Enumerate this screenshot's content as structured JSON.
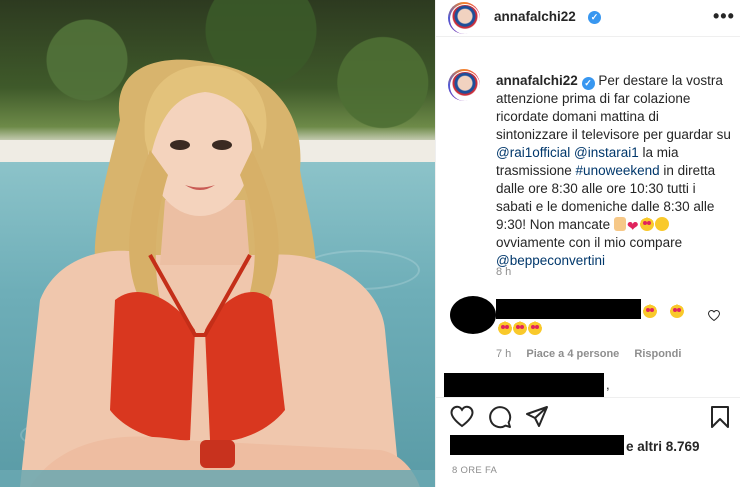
{
  "post": {
    "username": "annafalchi22",
    "more_icon": "more-horizontal-icon",
    "verified_icon": "verified-badge-icon"
  },
  "caption": {
    "username": "annafalchi22",
    "text_1": "Per destare la vostra attenzione prima di far colazione ricordate domani mattina di sintonizzare il televisore per guardar su",
    "mention_1": "@rai1official",
    "mention_2": "@instarai1",
    "text_2": "la mia trasmissione",
    "hashtag": "#unoweekend",
    "text_3": "in diretta dalle ore 8:30 alle ore 10:30 tutti i sabati e le domeniche dalle 8:30 alle 9:30! Non mancate",
    "text_4": "ovviamente con il mio compare",
    "mention_3": "@beppeconvertini",
    "time": "8 h"
  },
  "comment": {
    "time": "7 h",
    "likes": "Piace a 4 persone",
    "reply": "Rispondi"
  },
  "footer": {
    "likes_suffix": "e altri 8.769",
    "posted_ago": "8 ORE FA",
    "comma": ","
  },
  "colors": {
    "link": "#00376b",
    "muted": "#8e8e8e",
    "verified": "#3897f0"
  }
}
